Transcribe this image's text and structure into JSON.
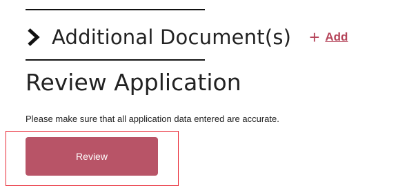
{
  "additional_documents": {
    "title": "Additional Document(s)",
    "add_label": "Add",
    "plus_symbol": "+",
    "chevron_icon": "chevron-right-icon",
    "accent_color": "#b5455a"
  },
  "review": {
    "heading": "Review Application",
    "description": "Please make sure that all application data entered are accurate.",
    "button_label": "Review",
    "button_color": "#b85467",
    "highlight_color": "#e8232f"
  }
}
